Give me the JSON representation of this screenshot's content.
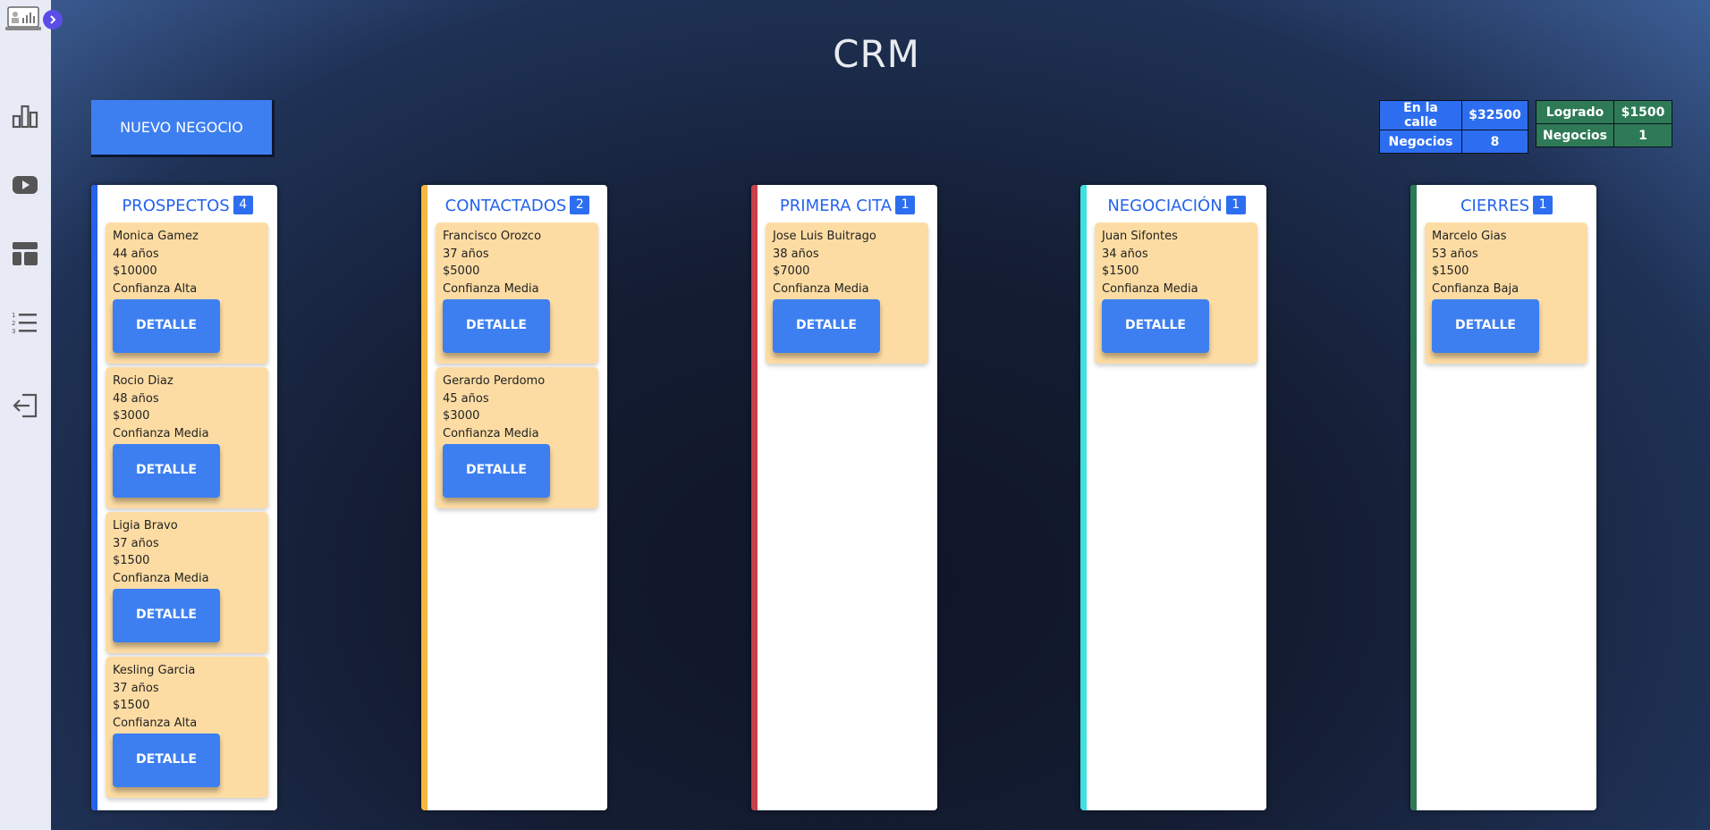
{
  "app": {
    "title": "CRM",
    "new_deal_label": "NUEVO NEGOCIO"
  },
  "sidebar": {
    "toggle_icon": "chevron-right-icon",
    "items": [
      {
        "icon": "bar-chart-icon"
      },
      {
        "icon": "play-icon"
      },
      {
        "icon": "layout-icon"
      },
      {
        "icon": "ordered-list-icon"
      },
      {
        "icon": "logout-icon"
      }
    ]
  },
  "stats": {
    "street": {
      "label": "En la calle",
      "value": "$32500",
      "deals_label": "Negocios",
      "deals": "8",
      "color": "#2d6ef0"
    },
    "achieved": {
      "label": "Logrado",
      "value": "$1500",
      "deals_label": "Negocios",
      "deals": "1",
      "color": "#2e7a56"
    }
  },
  "columns": [
    {
      "title": "PROSPECTOS",
      "count": "4",
      "color": "#2563eb",
      "cards": [
        {
          "name": "Monica Gamez",
          "age": "44 años",
          "amount": "$10000",
          "confidence": "Confianza Alta",
          "button": "DETALLE"
        },
        {
          "name": "Rocio Diaz",
          "age": "48 años",
          "amount": "$3000",
          "confidence": "Confianza Media",
          "button": "DETALLE"
        },
        {
          "name": "Ligia Bravo",
          "age": "37 años",
          "amount": "$1500",
          "confidence": "Confianza Media",
          "button": "DETALLE"
        },
        {
          "name": "Kesling Garcia",
          "age": "37 años",
          "amount": "$1500",
          "confidence": "Confianza Alta",
          "button": "DETALLE"
        }
      ]
    },
    {
      "title": "CONTACTADOS",
      "count": "2",
      "color": "#f5b83d",
      "cards": [
        {
          "name": "Francisco Orozco",
          "age": "37 años",
          "amount": "$5000",
          "confidence": "Confianza Media",
          "button": "DETALLE"
        },
        {
          "name": "Gerardo Perdomo",
          "age": "45 años",
          "amount": "$3000",
          "confidence": "Confianza Media",
          "button": "DETALLE"
        }
      ]
    },
    {
      "title": "PRIMERA CITA",
      "count": "1",
      "color": "#c9404a",
      "cards": [
        {
          "name": "Jose Luis Buitrago",
          "age": "38 años",
          "amount": "$7000",
          "confidence": "Confianza Media",
          "button": "DETALLE"
        }
      ]
    },
    {
      "title": "NEGOCIACIÓN",
      "count": "1",
      "color": "#3fe0e0",
      "cards": [
        {
          "name": "Juan Sifontes",
          "age": "34 años",
          "amount": "$1500",
          "confidence": "Confianza Media",
          "button": "DETALLE"
        }
      ]
    },
    {
      "title": "CIERRES",
      "count": "1",
      "color": "#2e7a56",
      "cards": [
        {
          "name": "Marcelo Gias",
          "age": "53 años",
          "amount": "$1500",
          "confidence": "Confianza Baja",
          "button": "DETALLE"
        }
      ]
    }
  ]
}
